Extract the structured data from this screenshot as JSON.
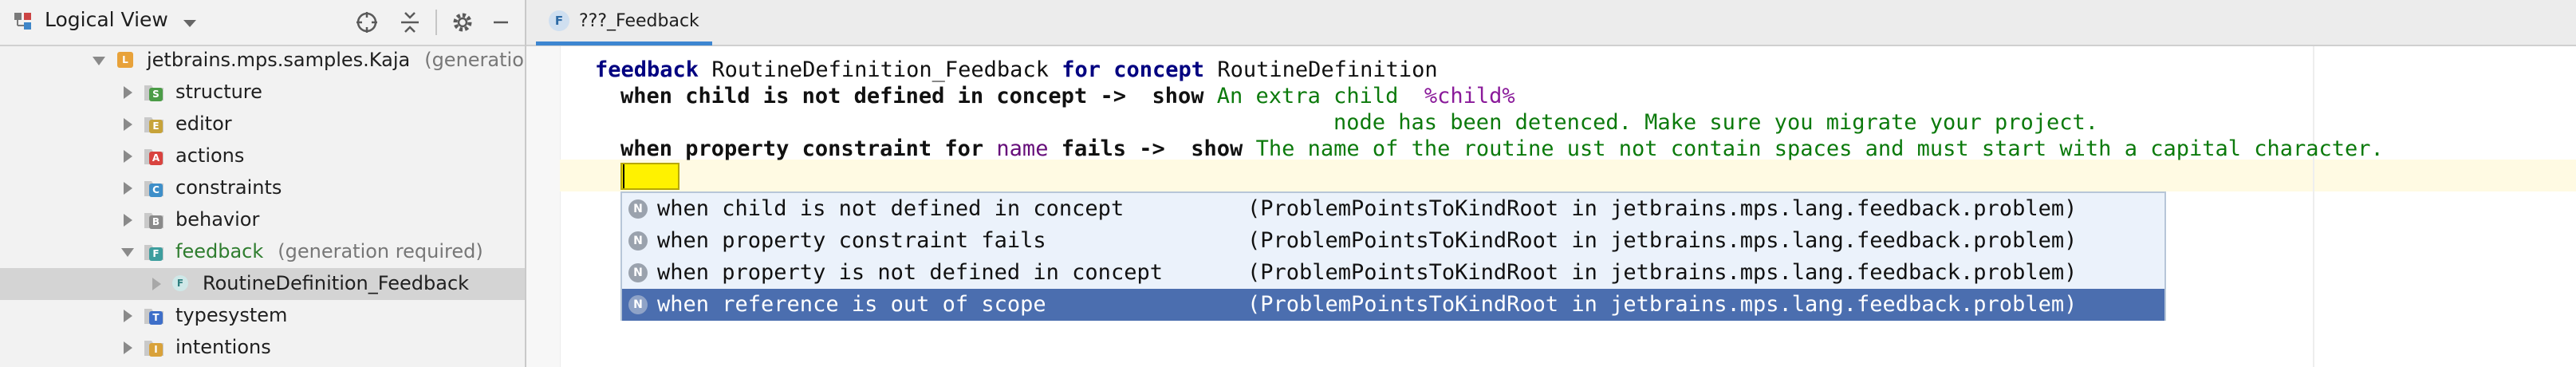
{
  "project_panel": {
    "title": "Logical View",
    "tools": [
      "crosshair-icon",
      "collapse-all-icon",
      "gear-icon",
      "minimize-icon"
    ],
    "tree": [
      {
        "label": "jetbrains.mps.samples.Kaja",
        "hint": "(generatio",
        "icon": "L",
        "color": "#e8a23a",
        "expanded": true,
        "level": 0
      },
      {
        "label": "structure",
        "icon": "S",
        "color": "#4b9c47",
        "level": 1
      },
      {
        "label": "editor",
        "icon": "E",
        "color": "#c7a33a",
        "level": 1
      },
      {
        "label": "actions",
        "icon": "A",
        "color": "#d9433f",
        "level": 1
      },
      {
        "label": "constraints",
        "icon": "C",
        "color": "#3e8fc9",
        "level": 1
      },
      {
        "label": "behavior",
        "icon": "B",
        "color": "#8a8a8a",
        "level": 1
      },
      {
        "label": "feedback",
        "hint": "(generation required)",
        "icon": "F",
        "color": "#3e9e9e",
        "expanded": true,
        "level": 1,
        "label_color": "#2f7d2f"
      },
      {
        "label": "RoutineDefinition_Feedback",
        "icon": "F",
        "color": "#3e9e9e",
        "level": 2,
        "selected": true
      },
      {
        "label": "typesystem",
        "icon": "T",
        "color": "#3e6fc9",
        "level": 1
      },
      {
        "label": "intentions",
        "icon": "I",
        "color": "#d9a23a",
        "level": 1
      }
    ]
  },
  "editor_tab": {
    "icon": "F",
    "label": "???_Feedback"
  },
  "code": {
    "line1": {
      "kw1": "feedback",
      "name": "RoutineDefinition_Feedback",
      "kw2": "for",
      "kw3": "concept",
      "concept": "RoutineDefinition"
    },
    "line2": {
      "when": "when child is not defined in concept ->",
      "show": "show",
      "msg": "An extra child",
      "var": "%child%"
    },
    "line3": {
      "msg": "node has been detenced. Make sure you migrate your project."
    },
    "line4": {
      "when_a": "when property constraint for",
      "prop": "name",
      "when_b": "fails ->",
      "show": "show",
      "msg": "The name of the routine ust not contain spaces and must start with a capital character."
    }
  },
  "completion": {
    "items": [
      {
        "label": "when child is not defined in concept",
        "source": "(ProblemPointsToKindRoot in jetbrains.mps.lang.feedback.problem)",
        "selected": false
      },
      {
        "label": "when property constraint fails",
        "source": "(ProblemPointsToKindRoot in jetbrains.mps.lang.feedback.problem)",
        "selected": false
      },
      {
        "label": "when property is not defined in concept",
        "source": "(ProblemPointsToKindRoot in jetbrains.mps.lang.feedback.problem)",
        "selected": false
      },
      {
        "label": "when reference is out of scope",
        "source": "(ProblemPointsToKindRoot in jetbrains.mps.lang.feedback.problem)",
        "selected": true
      }
    ],
    "item_icon": "N"
  }
}
